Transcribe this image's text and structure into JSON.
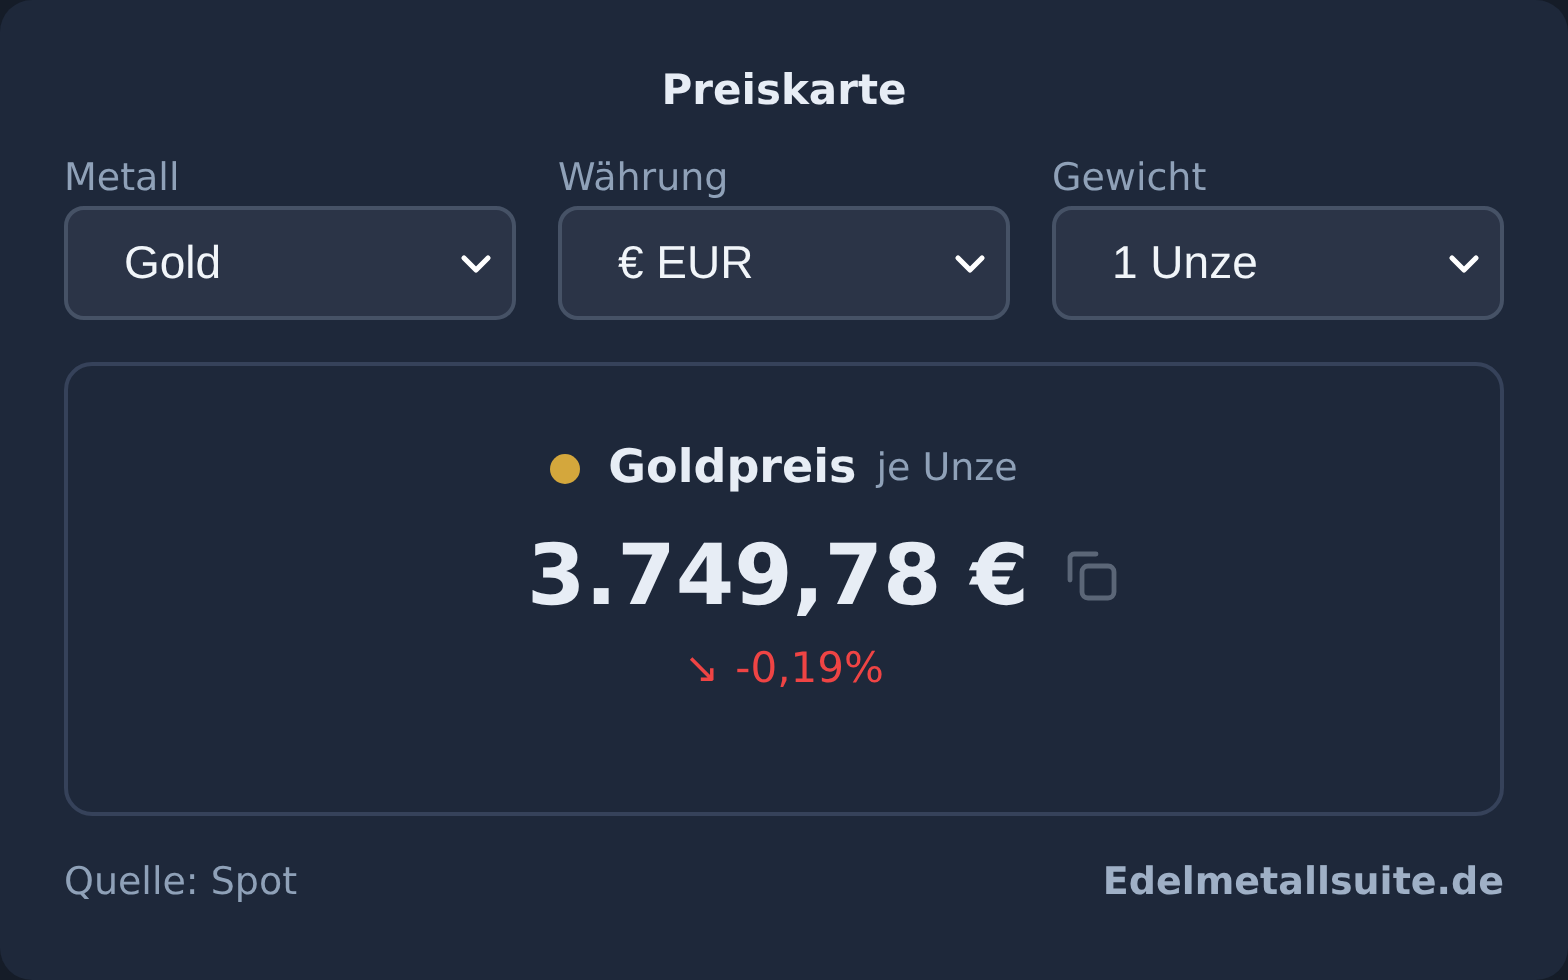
{
  "title": "Preiskarte",
  "selects": [
    {
      "label": "Metall",
      "value": "Gold"
    },
    {
      "label": "Währung",
      "value": "€ EUR"
    },
    {
      "label": "Gewicht",
      "value": "1 Unze"
    }
  ],
  "price": {
    "color": "#d4a73c",
    "name": "Goldpreis",
    "unit": "je Unze",
    "value": "3.749,78 €",
    "change": {
      "kind": "down",
      "arrow": "↘",
      "text": "-0,19%"
    }
  },
  "footer": {
    "source": "Quelle: Spot",
    "link": "Edelmetallsuite.de"
  }
}
